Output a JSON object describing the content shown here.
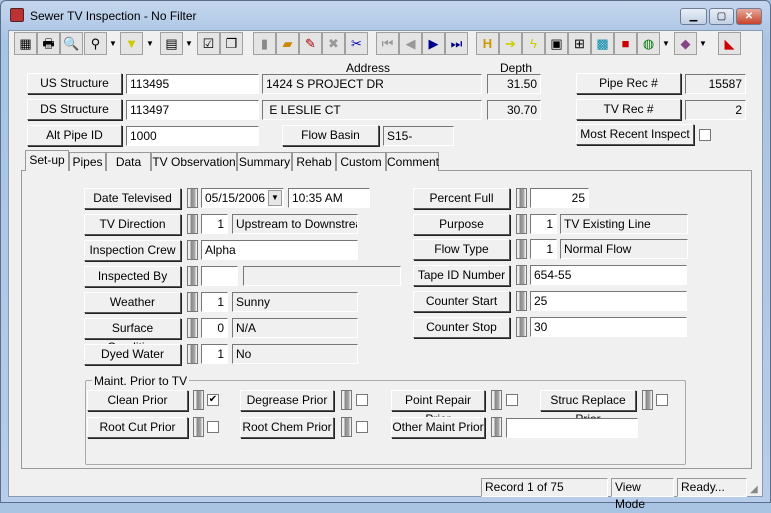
{
  "window": {
    "title": "Sewer TV Inspection - No Filter",
    "icon": "tv-icon",
    "controls": [
      "minimize",
      "maximize",
      "close"
    ]
  },
  "toolbar": {
    "icons": [
      "blank-icon",
      "print-icon",
      "preview-icon",
      "binoculars-icon",
      "filter-icon",
      "report-icon",
      "properties-icon",
      "copy-icon",
      "save-icon",
      "add-record-icon",
      "edit-pencil-icon",
      "delete-x-icon",
      "scissors-icon",
      "first-record-icon",
      "previous-record-icon",
      "next-record-icon",
      "last-record-icon",
      "h-icon",
      "arrow-right-icon",
      "lightning-icon",
      "diagram-icon",
      "flowchart-icon",
      "monitor-icon",
      "toolbox-icon",
      "globe-icon",
      "book-icon",
      "exit-icon"
    ]
  },
  "header": {
    "address_label": "Address",
    "depth_label": "Depth",
    "us_structure": {
      "label": "US Structure",
      "value": "113495",
      "address": "1424  S  PROJECT DR",
      "depth": "31.50"
    },
    "ds_structure": {
      "label": "DS Structure",
      "value": "113497",
      "address": " E LESLIE CT",
      "depth": "30.70"
    },
    "alt_pipe": {
      "label": "Alt Pipe ID",
      "value": "1000"
    },
    "flow_basin": {
      "label": "Flow Basin",
      "value": "S15-"
    },
    "pipe_rec": {
      "label": "Pipe Rec #",
      "value": "15587"
    },
    "tv_rec": {
      "label": "TV Rec #",
      "value": "2"
    },
    "most_recent": {
      "label": "Most Recent Inspect",
      "checked": false
    }
  },
  "tabs": [
    "Set-up",
    "Pipes",
    "Data",
    "TV Observation",
    "Summary",
    "Rehab",
    "Custom",
    "Comment"
  ],
  "active_tab": "Set-up",
  "setup": {
    "date_televised": {
      "label": "Date Televised",
      "date": "05/15/2006",
      "time": "10:35 AM"
    },
    "tv_direction": {
      "label": "TV Direction",
      "code": "1",
      "desc": "Upstream to Downstream"
    },
    "inspection_crew": {
      "label": "Inspection Crew",
      "value": "Alpha"
    },
    "inspected_by": {
      "label": "Inspected By",
      "code": "",
      "desc": ""
    },
    "weather": {
      "label": "Weather",
      "code": "1",
      "desc": "Sunny"
    },
    "surface_condition": {
      "label": "Surface Condition",
      "code": "0",
      "desc": "N/A"
    },
    "dyed_water": {
      "label": "Dyed Water",
      "code": "1",
      "desc": "No"
    },
    "percent_full": {
      "label": "Percent Full",
      "value": "25"
    },
    "purpose": {
      "label": "Purpose",
      "code": "1",
      "desc": "TV Existing Line"
    },
    "flow_type": {
      "label": "Flow Type",
      "code": "1",
      "desc": "Normal Flow"
    },
    "tape_id": {
      "label": "Tape ID Number",
      "value": "654-55"
    },
    "counter_start": {
      "label": "Counter Start",
      "value": "25"
    },
    "counter_stop": {
      "label": "Counter Stop",
      "value": "30"
    }
  },
  "maint": {
    "title": "Maint. Prior to TV",
    "clean": {
      "label": "Clean Prior",
      "checked": true,
      "mark": "✔"
    },
    "degrease": {
      "label": "Degrease Prior",
      "checked": false
    },
    "point_repair": {
      "label": "Point Repair Prior",
      "checked": false
    },
    "struc_replace": {
      "label": "Struc Replace Prior",
      "checked": false
    },
    "root_cut": {
      "label": "Root Cut Prior",
      "checked": false
    },
    "root_chem": {
      "label": "Root Chem Prior",
      "checked": false
    },
    "other": {
      "label": "Other Maint Prior",
      "value": ""
    }
  },
  "status": {
    "record": "Record 1 of 75",
    "mode": "View Mode",
    "state": "Ready..."
  }
}
